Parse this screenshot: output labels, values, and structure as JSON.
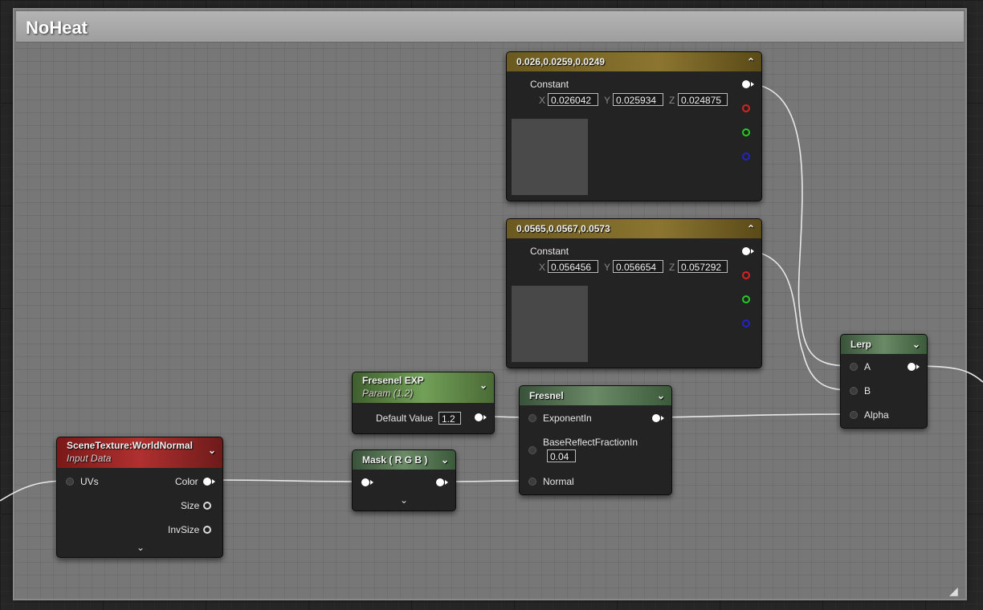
{
  "comment": {
    "title": "NoHeat"
  },
  "constant1": {
    "title": "0.026,0.0259,0.0249",
    "label": "Constant",
    "x_label": "X",
    "y_label": "Y",
    "z_label": "Z",
    "x": "0.026042",
    "y": "0.025934",
    "z": "0.024875",
    "preview_color": "#4a4a4a"
  },
  "constant2": {
    "title": "0.0565,0.0567,0.0573",
    "label": "Constant",
    "x_label": "X",
    "y_label": "Y",
    "z_label": "Z",
    "x": "0.056456",
    "y": "0.056654",
    "z": "0.057292",
    "preview_color": "#484848"
  },
  "lerp": {
    "title": "Lerp",
    "a": "A",
    "b": "B",
    "alpha": "Alpha"
  },
  "fresnel_exp": {
    "title": "Fresenel EXP",
    "subtitle": "Param (1.2)",
    "default_label": "Default Value",
    "default_value": "1.2"
  },
  "fresnel": {
    "title": "Fresnel",
    "exponent_in": "ExponentIn",
    "base_reflect": "BaseReflectFractionIn",
    "base_reflect_value": "0.04",
    "normal": "Normal"
  },
  "mask": {
    "title": "Mask ( R G B )"
  },
  "scene_texture": {
    "title": "SceneTexture:WorldNormal",
    "subtitle": "Input Data",
    "uvs": "UVs",
    "color": "Color",
    "size": "Size",
    "invsize": "InvSize"
  },
  "icons": {
    "collapse": "chevron-up-icon",
    "expand": "chevron-down-icon",
    "resize": "resize-grip-icon"
  },
  "colors": {
    "const_header": "#8b7530",
    "param_header": "#72a058",
    "fresnel_header": "#6a8a66",
    "texture_header": "#b03030",
    "comment_bg": "#777777"
  }
}
